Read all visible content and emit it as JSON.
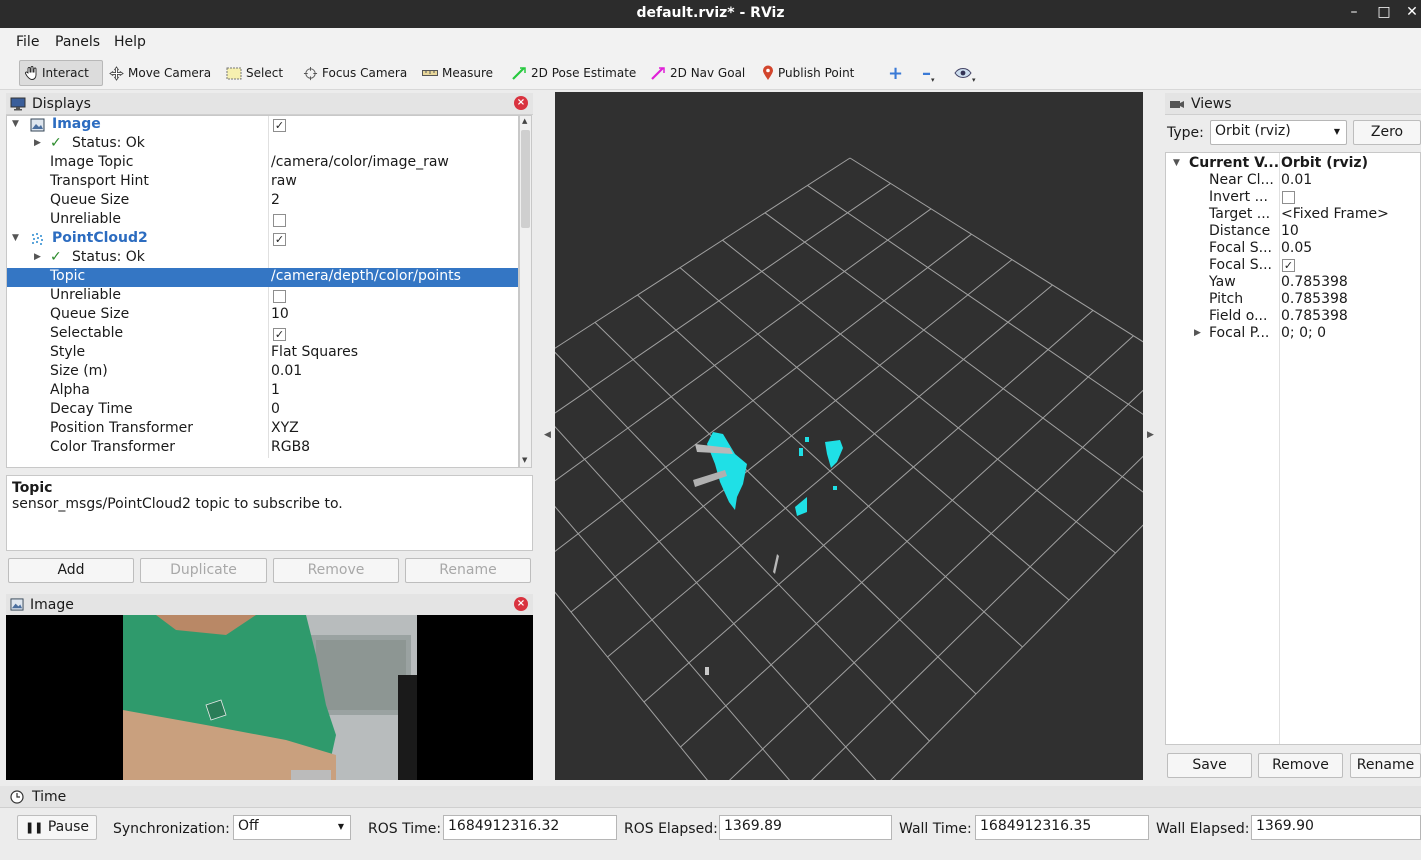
{
  "window": {
    "title": "default.rviz* - RViz",
    "minimize": "–",
    "maximize": "□",
    "close": "✕"
  },
  "menu": {
    "file": "File",
    "panels": "Panels",
    "help": "Help"
  },
  "toolbar": {
    "interact": "Interact",
    "move_camera": "Move Camera",
    "select": "Select",
    "focus_camera": "Focus Camera",
    "measure": "Measure",
    "pose_estimate": "2D Pose Estimate",
    "nav_goal": "2D Nav Goal",
    "publish_point": "Publish Point"
  },
  "displays": {
    "title": "Displays",
    "image": {
      "name": "Image",
      "status": "Status: Ok",
      "props": [
        {
          "key": "Image Topic",
          "value": "/camera/color/image_raw"
        },
        {
          "key": "Transport Hint",
          "value": "raw"
        },
        {
          "key": "Queue Size",
          "value": "2"
        },
        {
          "key": "Unreliable",
          "value": ""
        }
      ]
    },
    "pointcloud": {
      "name": "PointCloud2",
      "status": "Status: Ok",
      "topic_key": "Topic",
      "topic_value": "/camera/depth/color/points",
      "props": [
        {
          "key": "Unreliable",
          "value": ""
        },
        {
          "key": "Queue Size",
          "value": "10"
        },
        {
          "key": "Selectable",
          "value": ""
        },
        {
          "key": "Style",
          "value": "Flat Squares"
        },
        {
          "key": "Size (m)",
          "value": "0.01"
        },
        {
          "key": "Alpha",
          "value": "1"
        },
        {
          "key": "Decay Time",
          "value": "0"
        },
        {
          "key": "Position Transformer",
          "value": "XYZ"
        },
        {
          "key": "Color Transformer",
          "value": "RGB8"
        }
      ]
    },
    "desc_title": "Topic",
    "desc_text": "sensor_msgs/PointCloud2 topic to subscribe to.",
    "buttons": {
      "add": "Add",
      "duplicate": "Duplicate",
      "remove": "Remove",
      "rename": "Rename"
    }
  },
  "image_panel": {
    "title": "Image"
  },
  "views": {
    "title": "Views",
    "type_label": "Type:",
    "type_value": "Orbit (rviz)",
    "zero": "Zero",
    "current_key": "Current V...",
    "current_value": "Orbit (rviz)",
    "props": [
      {
        "key": "Near Cl...",
        "value": "0.01"
      },
      {
        "key": "Invert ...",
        "value": ""
      },
      {
        "key": "Target ...",
        "value": "<Fixed Frame>"
      },
      {
        "key": "Distance",
        "value": "10"
      },
      {
        "key": "Focal S...",
        "value": "0.05"
      },
      {
        "key": "Focal S...",
        "value": ""
      },
      {
        "key": "Yaw",
        "value": "0.785398"
      },
      {
        "key": "Pitch",
        "value": "0.785398"
      },
      {
        "key": "Field o...",
        "value": "0.785398"
      },
      {
        "key": "Focal P...",
        "value": "0; 0; 0"
      }
    ],
    "buttons": {
      "save": "Save",
      "remove": "Remove",
      "rename": "Rename"
    }
  },
  "time": {
    "title": "Time",
    "pause": "Pause",
    "sync_label": "Synchronization:",
    "sync_value": "Off",
    "ros_time_label": "ROS Time:",
    "ros_time": "1684912316.32",
    "ros_elapsed_label": "ROS Elapsed:",
    "ros_elapsed": "1369.89",
    "wall_time_label": "Wall Time:",
    "wall_time": "1684912316.35",
    "wall_elapsed_label": "Wall Elapsed:",
    "wall_elapsed": "1369.90"
  },
  "colors": {
    "selection": "#3476c4",
    "viewport": "#303030",
    "cloud": "#1fe0e6",
    "link": "#2c6cc0"
  }
}
